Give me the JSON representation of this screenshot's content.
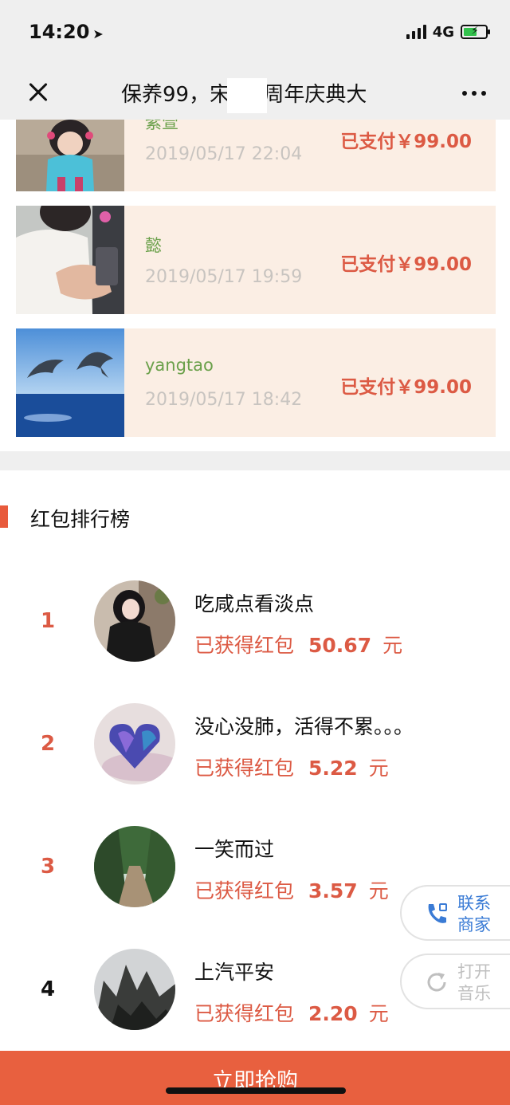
{
  "status_bar": {
    "time": "14:20",
    "location_glyph": "➤",
    "network": "4G",
    "battery_glyph": "⚡",
    "battery_level": 0.6
  },
  "nav": {
    "title": "保养99，宋 14周年庆典大",
    "close_icon": "close-icon",
    "more_icon": "more-icon"
  },
  "orders": [
    {
      "name": "紫萱",
      "time": "2019/05/17 22:04",
      "status": "已支付￥99.00"
    },
    {
      "name": "懿",
      "time": "2019/05/17 19:59",
      "status": "已支付￥99.00"
    },
    {
      "name": "yangtao",
      "time": "2019/05/17 18:42",
      "status": "已支付￥99.00"
    }
  ],
  "ranking": {
    "title": "红包排行榜",
    "items": [
      {
        "rank": "1",
        "name": "吃咸点看淡点",
        "label": "已获得红包",
        "amount": "50.67",
        "unit": "元"
      },
      {
        "rank": "2",
        "name": "没心没肺，活得不累。。。",
        "label": "已获得红包",
        "amount": "5.22",
        "unit": "元"
      },
      {
        "rank": "3",
        "name": "一笑而过",
        "label": "已获得红包",
        "amount": "3.57",
        "unit": "元"
      },
      {
        "rank": "4",
        "name": "上汽平安",
        "label": "已获得红包",
        "amount": "2.20",
        "unit": "元"
      }
    ]
  },
  "floating": {
    "contact": {
      "line1": "联系",
      "line2": "商家",
      "icon": "phone-icon"
    },
    "music": {
      "line1": "打开",
      "line2": "音乐",
      "icon": "refresh-icon"
    }
  },
  "buy_button": {
    "label": "立即抢购"
  },
  "colors": {
    "accent": "#e8603f",
    "price_red": "#dc5a44",
    "order_bg": "#fbeee4",
    "name_green": "#6aa04a",
    "contact_blue": "#3a7bd5",
    "muted_gray": "#bfbfbf"
  }
}
